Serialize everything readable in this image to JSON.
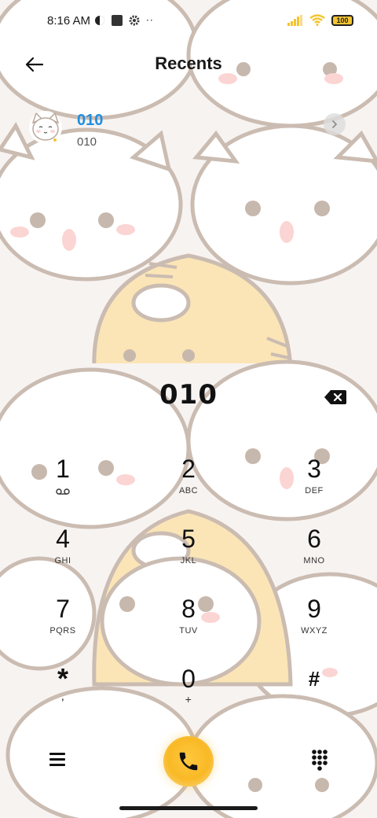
{
  "status_bar": {
    "time": "8:16 AM",
    "icons_left": [
      "hotspot-icon",
      "square-icon",
      "gear-icon",
      "more-dots-icon"
    ],
    "icons_right": [
      "signal-icon",
      "wifi-icon",
      "battery-icon"
    ],
    "battery_level": "100"
  },
  "header": {
    "title": "Recents",
    "back_icon": "arrow-left-icon"
  },
  "recents": [
    {
      "name": "010",
      "number": "010",
      "avatar": "cat-avatar-icon",
      "detail_icon": "chevron-right-icon"
    }
  ],
  "dialer": {
    "display_value": "010",
    "backspace_icon": "backspace-icon",
    "keys": [
      {
        "digit": "1",
        "letters": ""
      },
      {
        "digit": "2",
        "letters": "ABC"
      },
      {
        "digit": "3",
        "letters": "DEF"
      },
      {
        "digit": "4",
        "letters": "GHI"
      },
      {
        "digit": "5",
        "letters": "JKL"
      },
      {
        "digit": "6",
        "letters": "MNO"
      },
      {
        "digit": "7",
        "letters": "PQRS"
      },
      {
        "digit": "8",
        "letters": "TUV"
      },
      {
        "digit": "9",
        "letters": "WXYZ"
      },
      {
        "digit": "*",
        "letters": ","
      },
      {
        "digit": "0",
        "letters": "+"
      },
      {
        "digit": "#",
        "letters": ""
      }
    ]
  },
  "bottom_bar": {
    "menu_icon": "menu-icon",
    "call_icon": "phone-icon",
    "keypad_icon": "dialpad-icon"
  },
  "colors": {
    "accent": "#1e8fe1",
    "call_button": "#f9b926",
    "wallpaper_cat": "#ffffff",
    "wallpaper_tiger": "#fbe5b6",
    "wallpaper_outline": "#c9b9ae"
  }
}
